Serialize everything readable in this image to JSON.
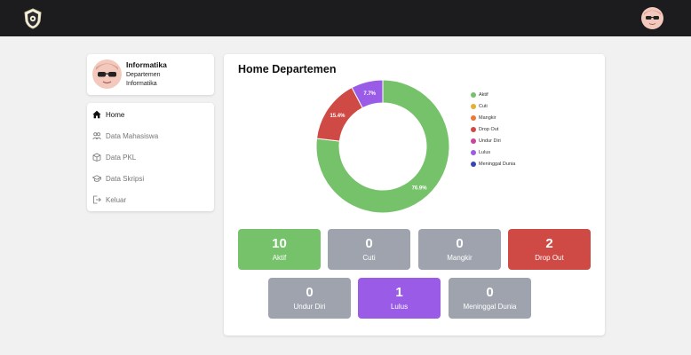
{
  "profile": {
    "name": "Informatika",
    "line1": "Departemen",
    "line2": "Informatika"
  },
  "menu": {
    "items": [
      {
        "label": "Home",
        "icon": "home-icon",
        "active": true
      },
      {
        "label": "Data Mahasiswa",
        "icon": "users-icon",
        "active": false
      },
      {
        "label": "Data PKL",
        "icon": "box-icon",
        "active": false
      },
      {
        "label": "Data Skripsi",
        "icon": "graduation-cap-icon",
        "active": false
      },
      {
        "label": "Keluar",
        "icon": "logout-icon",
        "active": false
      }
    ]
  },
  "main": {
    "title": "Home Departemen"
  },
  "chart_data": {
    "type": "pie",
    "variant": "doughnut",
    "categories": [
      "Aktif",
      "Cuti",
      "Mangkir",
      "Drop Out",
      "Undur Diri",
      "Lulus",
      "Meninggal Dunia"
    ],
    "values": [
      10,
      0,
      0,
      2,
      0,
      1,
      0
    ],
    "colors": [
      "#76c26b",
      "#e2b032",
      "#e8793a",
      "#cf4a45",
      "#c8479a",
      "#9a5ce6",
      "#3a45b5"
    ],
    "slice_labels": [
      "76.9%",
      "",
      "",
      "15.4%",
      "",
      "7.7%",
      ""
    ],
    "legend_position": "right"
  },
  "stats": [
    {
      "value": "10",
      "label": "Aktif",
      "color": "#76c26b"
    },
    {
      "value": "0",
      "label": "Cuti",
      "color": "#9ea3ad"
    },
    {
      "value": "0",
      "label": "Mangkir",
      "color": "#9ea3ad"
    },
    {
      "value": "2",
      "label": "Drop Out",
      "color": "#cf4a45"
    },
    {
      "value": "0",
      "label": "Undur Diri",
      "color": "#9ea3ad"
    },
    {
      "value": "1",
      "label": "Lulus",
      "color": "#9a5ce6"
    },
    {
      "value": "0",
      "label": "Meninggal Dunia",
      "color": "#9ea3ad"
    }
  ]
}
